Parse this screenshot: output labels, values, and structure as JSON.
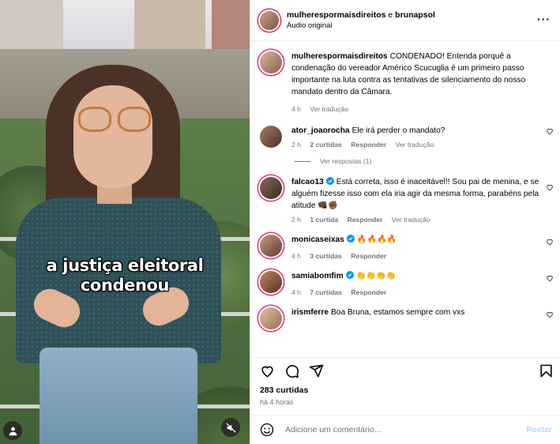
{
  "header": {
    "account1": "mulherespormaisdireitos",
    "connector": "e",
    "account2": "brunapsol",
    "audio": "Áudio original"
  },
  "video": {
    "caption_line1": "a justiça eleitoral",
    "caption_line2": "condenou"
  },
  "caption_comment": {
    "username": "mulherespormaisdireitos",
    "text": "CONDENADO! Entenda porquê a condenação do vereador Américo Scucuglia é um primeiro passo importante na luta contra as tentativas de silenciamento do nosso mandato dentro da Câmara.",
    "time": "4 h",
    "translate": "Ver tradução"
  },
  "comments": [
    {
      "username": "ator_joaorocha",
      "text": "Ele irá perder o mandato?",
      "time": "2 h",
      "likes": "2 curtidas",
      "reply": "Responder",
      "translate": "Ver tradução",
      "view_replies": "Ver respostas (1)"
    },
    {
      "username": "falcao13",
      "verified": true,
      "text": "Está correta, isso é inaceitável!! Sou pai de menina, e se alguém fizesse isso com ela iria agir da mesma forma, parabéns pela atitude 👊🏿✊🏾",
      "time": "2 h",
      "likes": "1 curtida",
      "reply": "Responder",
      "translate": "Ver tradução"
    },
    {
      "username": "monicaseixas",
      "verified": true,
      "text": "🔥🔥🔥🔥",
      "time": "4 h",
      "likes": "3 curtidas",
      "reply": "Responder"
    },
    {
      "username": "samiabomfim",
      "verified": true,
      "text": "👏👏👏👏",
      "time": "4 h",
      "likes": "7 curtidas",
      "reply": "Responder"
    },
    {
      "username": "irismferre",
      "text": "Boa Bruna, estamos sempre com vxs"
    }
  ],
  "footer": {
    "likes": "283 curtidas",
    "time": "há 4 horas",
    "add_comment_placeholder": "Adicione um comentário...",
    "post_button": "Postar"
  },
  "colors": {
    "link_secondary": "#737373",
    "verified_blue": "#0095f6",
    "post_button_disabled": "#b3dbff",
    "story_ring": "#e1306c"
  },
  "icons": [
    "more-options-icon",
    "heart-icon",
    "comment-icon",
    "share-icon",
    "save-icon",
    "emoji-icon",
    "user-tag-icon",
    "muted-speaker-icon",
    "verified-icon"
  ]
}
